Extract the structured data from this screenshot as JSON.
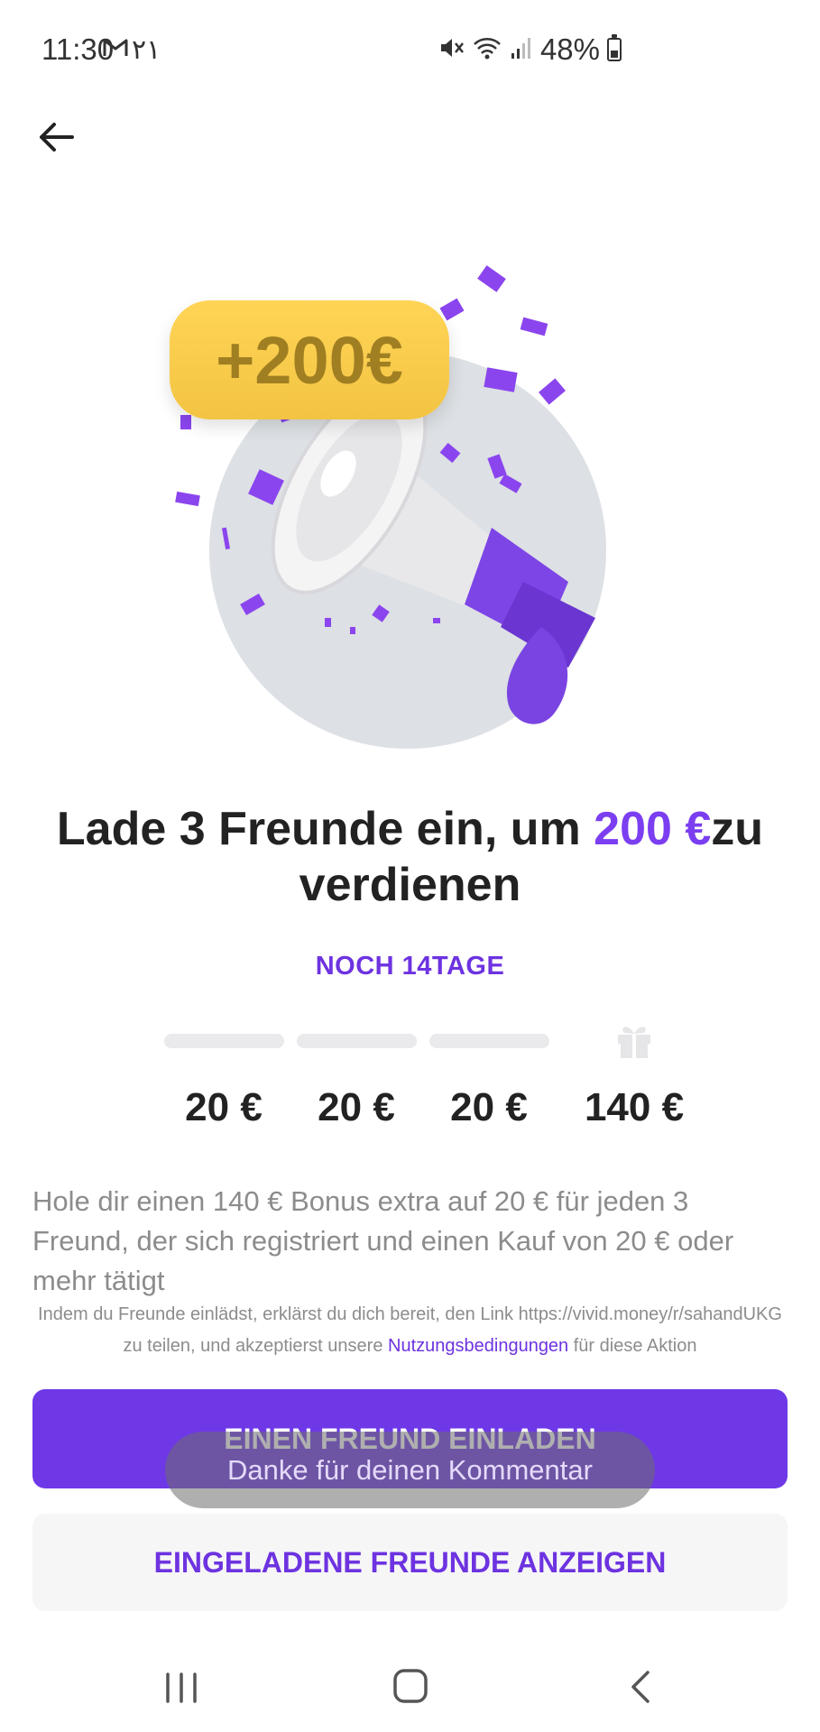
{
  "status_bar": {
    "time": "11:30",
    "extra": "٢١",
    "battery": "48%",
    "battery_level": 0.48
  },
  "hero": {
    "badge": "+200€"
  },
  "headline": {
    "part1": "Lade 3 Freunde ein, um ",
    "accent": "200 €",
    "part2": "zu verdienen"
  },
  "days_left": "NOCH 14TAGE",
  "rewards": [
    "20 €",
    "20 €",
    "20 €",
    "140 €"
  ],
  "description": "Hole dir einen 140 € Bonus extra auf 20 € für jeden 3 Freund, der sich registriert und einen Kauf von 20 € oder mehr tätigt",
  "terms": {
    "before": "Indem du Freunde einlädst, erklärst du dich bereit, den Link https://vivid.money/r/sahandUKG zu teilen, und akzeptierst unsere ",
    "link": "Nutzungsbedingungen",
    "after": " für diese Aktion"
  },
  "buttons": {
    "invite": "EINEN FREUND EINLADEN",
    "show_invited": "EINGELADENE FREUNDE ANZEIGEN"
  },
  "toast": "Danke für deinen Kommentar",
  "colors": {
    "accent": "#6e38e7",
    "badge": "#f3c443",
    "text_muted": "#8c8c8c"
  }
}
